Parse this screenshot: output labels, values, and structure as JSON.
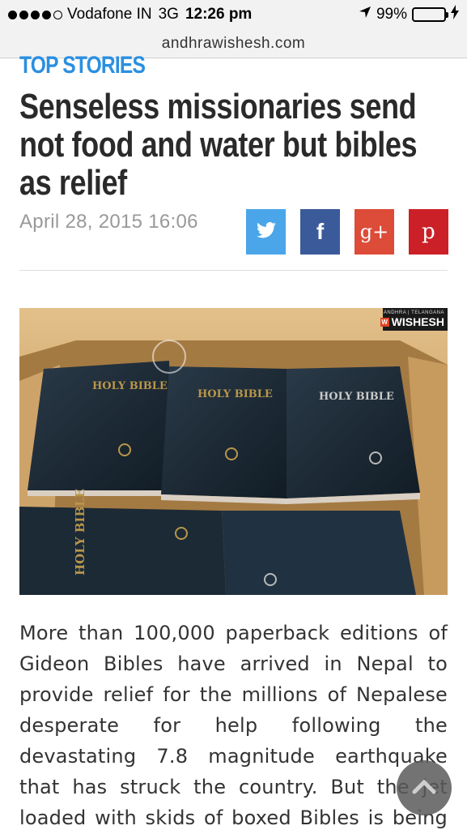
{
  "status_bar": {
    "carrier": "Vodafone IN",
    "network": "3G",
    "time": "12:26 pm",
    "battery_percent_label": "99%",
    "battery_level": 0.99,
    "signal_bars": 4,
    "icons": [
      "signal-dots-icon",
      "location-arrow-icon",
      "battery-icon",
      "charging-bolt-icon"
    ]
  },
  "browser": {
    "url": "andhrawishesh.com"
  },
  "article": {
    "section": "TOP STORIES",
    "headline": "Senseless missionaries send not food and water but bibles as relief",
    "date": "April 28, 2015 16:06",
    "body": "More than 100,000 paperback editions of Gideon Bibles have arrived in Nepal to provide relief for the millions of Nepalese desperate for help following the devastating 7.8 magnitude earthquake that has struck the country. But the jet loaded with skids of boxed Bibles is being called"
  },
  "share": {
    "twitter_icon": "twitter-icon",
    "facebook_glyph": "f",
    "gplus_glyph": "g+",
    "pinterest_glyph": "p",
    "colors": {
      "twitter": "#4aa6e9",
      "facebook": "#3b5a9a",
      "gplus": "#dd4b39",
      "pinterest": "#cb2027"
    }
  },
  "photo": {
    "watermark_top": "ANDHRA | TELANGANA",
    "watermark_brand": "WISHESH",
    "watermark_logo": "W",
    "book_labels": [
      "HOLY BIBLE",
      "HOLY BIBLE",
      "HOLY BIBLE",
      "HOLY BIBLE"
    ]
  },
  "colors": {
    "accent": "#2b8fe0",
    "headline": "#2a2a2a",
    "muted": "#999999"
  }
}
